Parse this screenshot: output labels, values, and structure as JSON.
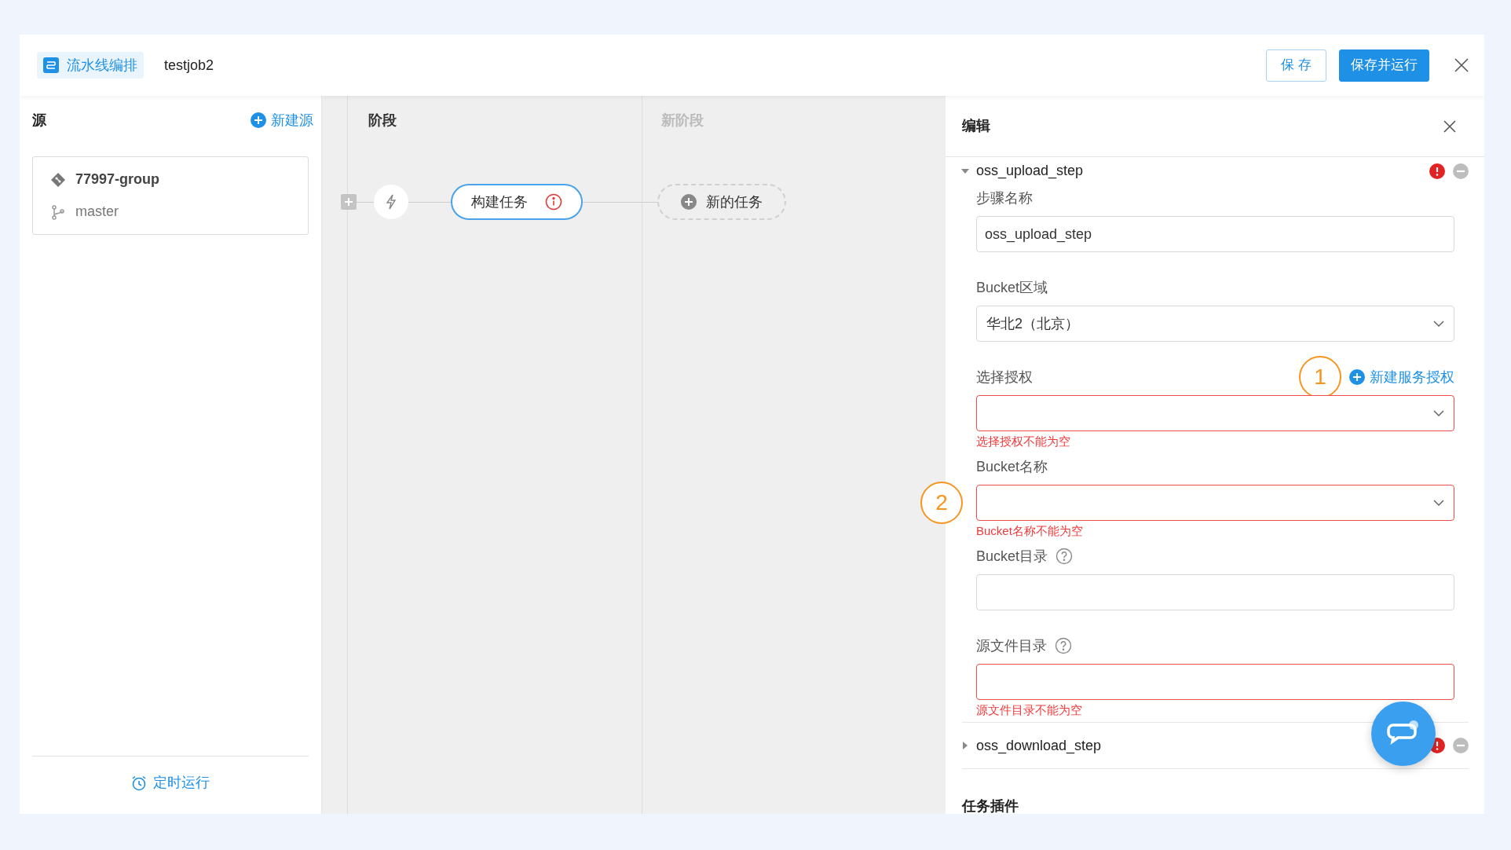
{
  "header": {
    "title_tag": "流水线编排",
    "job_name": "testjob2",
    "buttons": [
      {
        "label": "保 存",
        "kind": "secondary"
      },
      {
        "label": "保存并运行",
        "kind": "primary"
      }
    ]
  },
  "source_panel": {
    "title": "源",
    "add_link": "新建源",
    "repo": {
      "name": "77997-group",
      "branch": "master"
    },
    "footer_link": "定时运行"
  },
  "canvas": {
    "stage_title": "阶段",
    "new_stage_title": "新阶段",
    "task": {
      "label": "构建任务",
      "has_error": true
    },
    "new_task_label": "新的任务"
  },
  "editor": {
    "title": "编辑",
    "steps": [
      {
        "name": "oss_upload_step",
        "expanded": true,
        "has_error": true,
        "fields": [
          {
            "label": "步骤名称",
            "kind": "input",
            "value": "oss_upload_step",
            "help": false
          },
          {
            "label": "Bucket区域",
            "kind": "select",
            "value": "华北2（北京）",
            "help": false
          },
          {
            "label": "选择授权",
            "kind": "select",
            "help": false,
            "error": "选择授权不能为空",
            "annotation": "1",
            "action": "新建服务授权"
          },
          {
            "label": "Bucket名称",
            "kind": "select",
            "help": false,
            "error": "Bucket名称不能为空",
            "annotation": "2"
          },
          {
            "label": "Bucket目录",
            "kind": "input",
            "help": true
          },
          {
            "label": "源文件目录",
            "kind": "input",
            "help": true,
            "error": "源文件目录不能为空"
          }
        ]
      },
      {
        "name": "oss_download_step",
        "expanded": false,
        "has_error": true
      }
    ],
    "section_title": "任务插件"
  }
}
